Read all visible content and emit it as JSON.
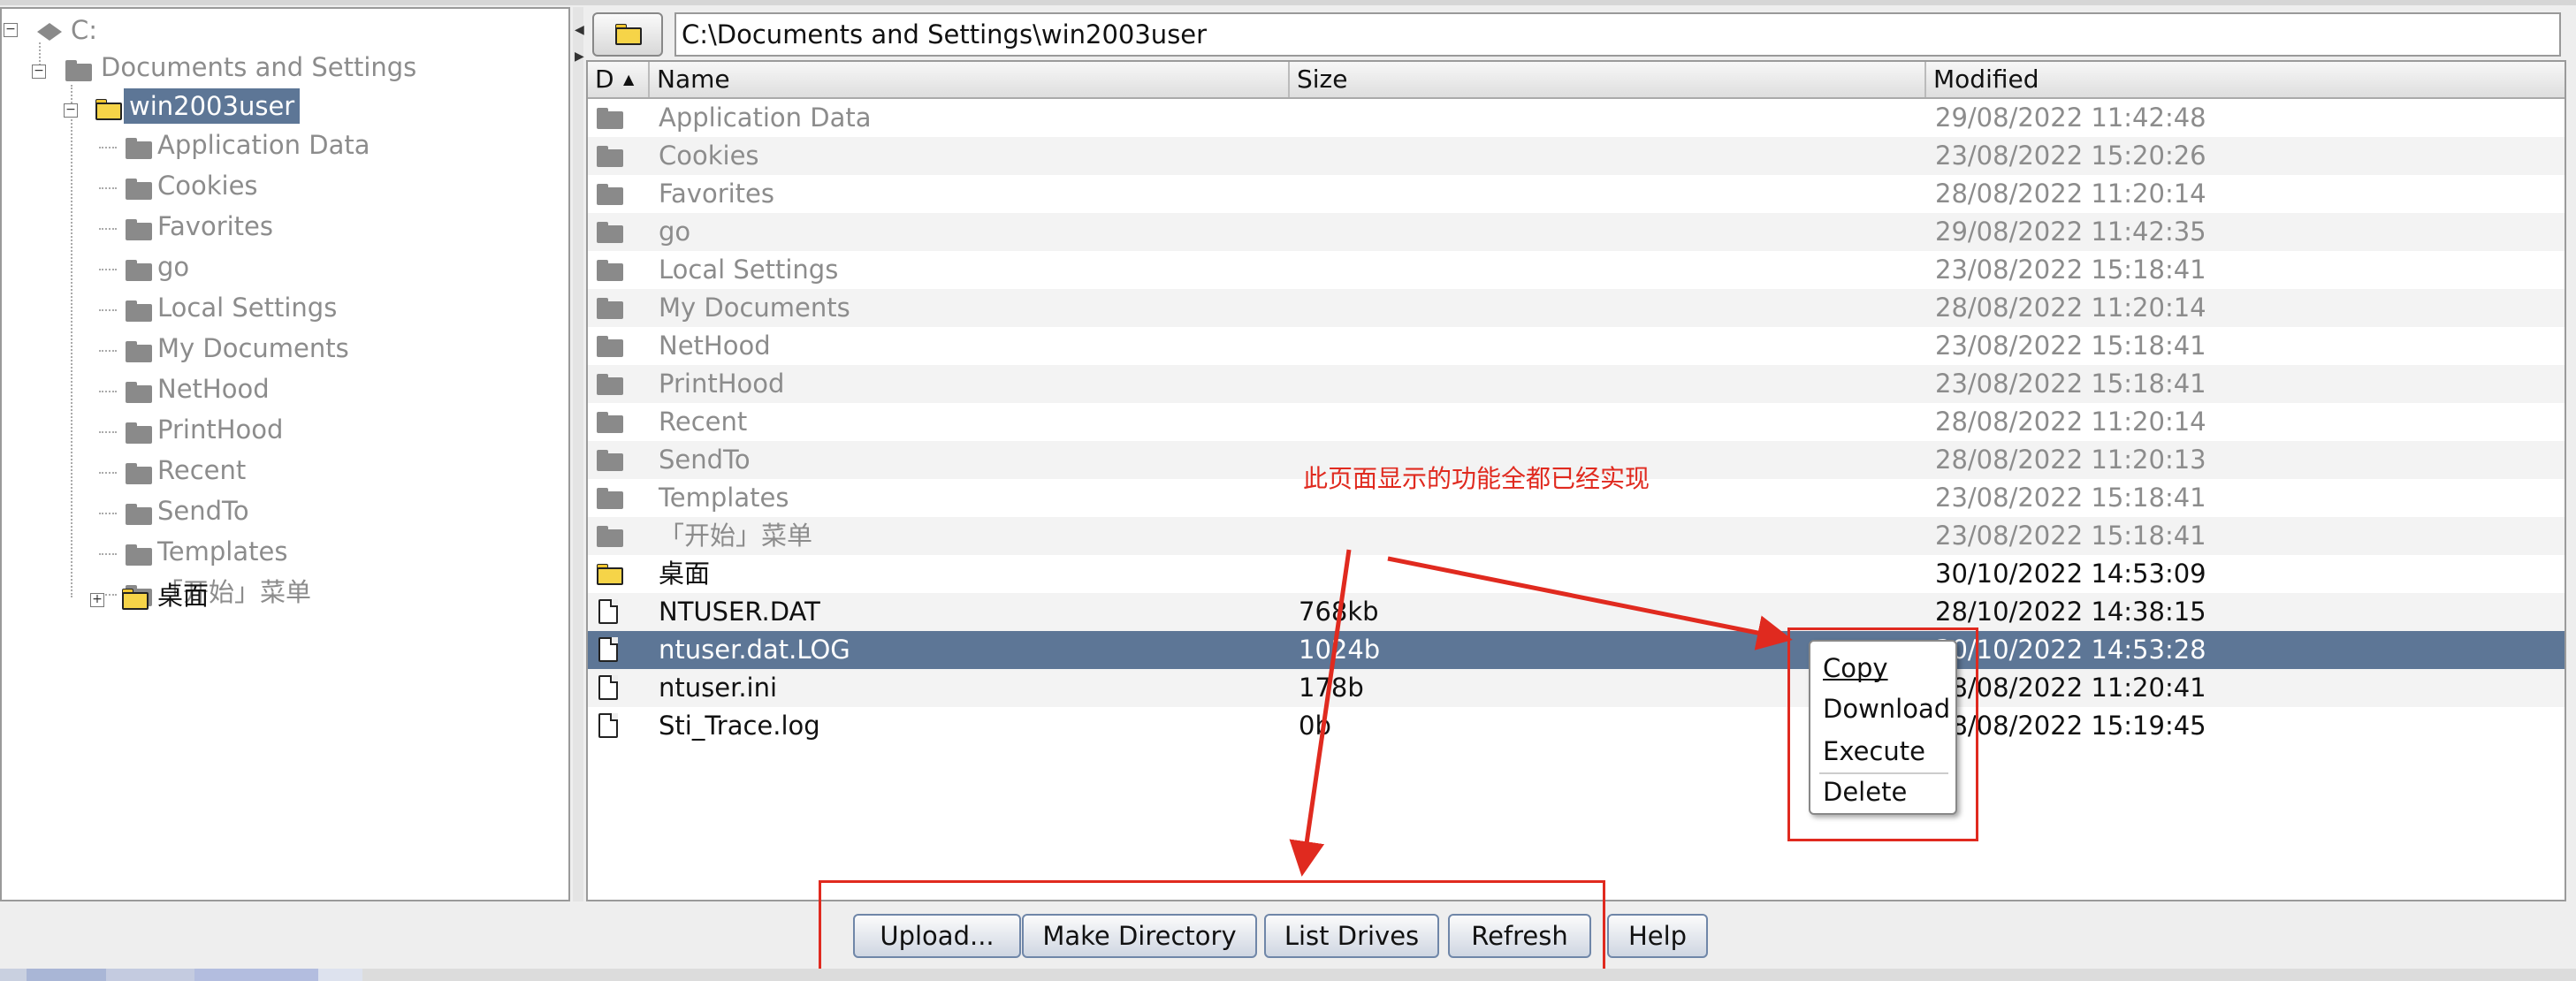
{
  "path": "C:\\Documents and Settings\\win2003user",
  "tree": {
    "root": "C:",
    "documents_and_settings": "Documents and Settings",
    "user": "win2003user",
    "children": [
      "Application Data",
      "Cookies",
      "Favorites",
      "go",
      "Local Settings",
      "My Documents",
      "NetHood",
      "PrintHood",
      "Recent",
      "SendTo",
      "Templates",
      "「开始」菜单"
    ],
    "desktop": "桌面"
  },
  "table": {
    "headers": {
      "d": "D",
      "sort_indicator": "▲",
      "name": "Name",
      "size": "Size",
      "modified": "Modified"
    },
    "rows": [
      {
        "name": "Application Data",
        "size": "",
        "modified": "29/08/2022 11:42:48",
        "kind": "folder-gray"
      },
      {
        "name": "Cookies",
        "size": "",
        "modified": "23/08/2022 15:20:26",
        "kind": "folder-gray"
      },
      {
        "name": "Favorites",
        "size": "",
        "modified": "28/08/2022 11:20:14",
        "kind": "folder-gray"
      },
      {
        "name": "go",
        "size": "",
        "modified": "29/08/2022 11:42:35",
        "kind": "folder-gray"
      },
      {
        "name": "Local Settings",
        "size": "",
        "modified": "23/08/2022 15:18:41",
        "kind": "folder-gray"
      },
      {
        "name": "My Documents",
        "size": "",
        "modified": "28/08/2022 11:20:14",
        "kind": "folder-gray"
      },
      {
        "name": "NetHood",
        "size": "",
        "modified": "23/08/2022 15:18:41",
        "kind": "folder-gray"
      },
      {
        "name": "PrintHood",
        "size": "",
        "modified": "23/08/2022 15:18:41",
        "kind": "folder-gray"
      },
      {
        "name": "Recent",
        "size": "",
        "modified": "28/08/2022 11:20:14",
        "kind": "folder-gray"
      },
      {
        "name": "SendTo",
        "size": "",
        "modified": "28/08/2022 11:20:13",
        "kind": "folder-gray"
      },
      {
        "name": "Templates",
        "size": "",
        "modified": "23/08/2022 15:18:41",
        "kind": "folder-gray"
      },
      {
        "name": "「开始」菜单",
        "size": "",
        "modified": "23/08/2022 15:18:41",
        "kind": "folder-gray"
      },
      {
        "name": "桌面",
        "size": "",
        "modified": "30/10/2022 14:53:09",
        "kind": "folder-yellow"
      },
      {
        "name": "NTUSER.DAT",
        "size": "768kb",
        "modified": "28/10/2022 14:38:15",
        "kind": "file"
      },
      {
        "name": "ntuser.dat.LOG",
        "size": "1024b",
        "modified": "30/10/2022 14:53:28",
        "kind": "file",
        "selected": true
      },
      {
        "name": "ntuser.ini",
        "size": "178b",
        "modified": "28/08/2022 11:20:41",
        "kind": "file"
      },
      {
        "name": "Sti_Trace.log",
        "size": "0b",
        "modified": "28/08/2022 15:19:45",
        "kind": "file"
      }
    ]
  },
  "context_menu": {
    "copy": "Copy",
    "download": "Download",
    "execute": "Execute",
    "delete": "Delete"
  },
  "annotation": "此页面显示的功能全都已经实现",
  "buttons": {
    "upload": "Upload...",
    "make_directory": "Make Directory",
    "list_drives": "List Drives",
    "refresh": "Refresh",
    "help": "Help"
  },
  "colors": {
    "selected_row": "#5d7696",
    "annotation_red": "#e02a1f"
  }
}
